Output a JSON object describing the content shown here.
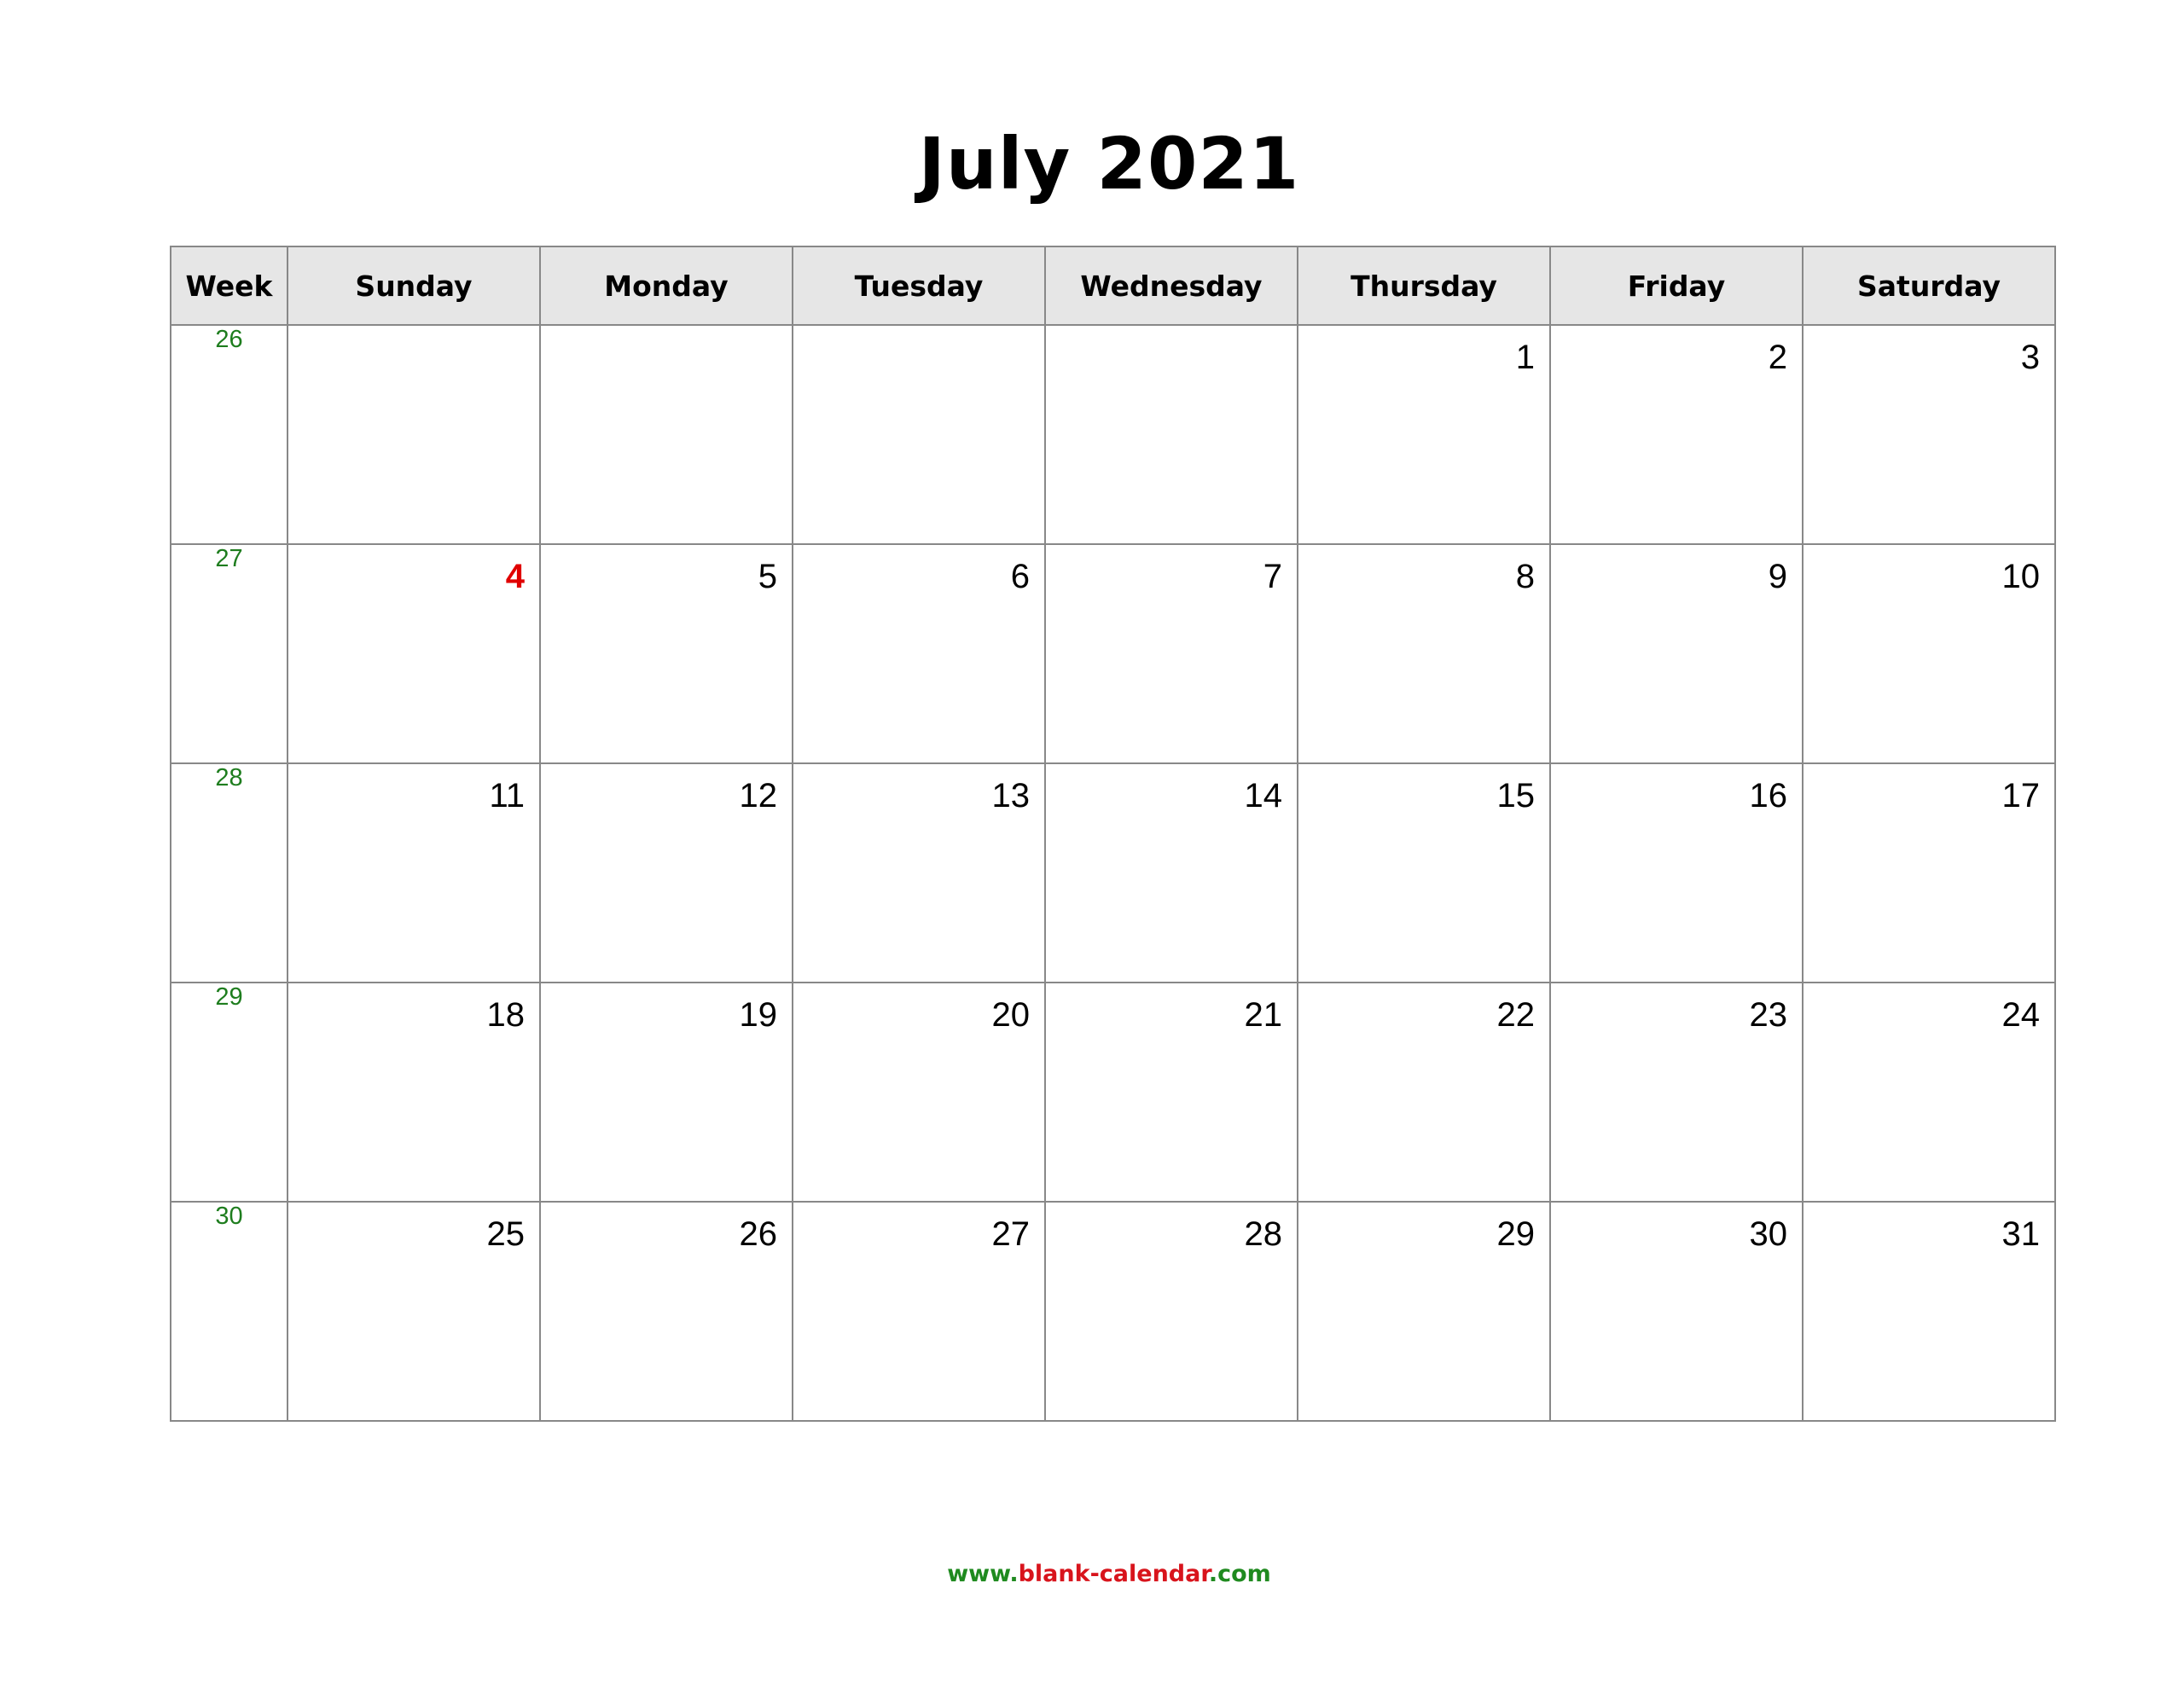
{
  "title": "July 2021",
  "header": {
    "week_label": "Week",
    "days": [
      "Sunday",
      "Monday",
      "Tuesday",
      "Wednesday",
      "Thursday",
      "Friday",
      "Saturday"
    ]
  },
  "weeks": [
    {
      "number": "26",
      "days": [
        "",
        "",
        "",
        "",
        "1",
        "2",
        "3"
      ]
    },
    {
      "number": "27",
      "days": [
        "4",
        "5",
        "6",
        "7",
        "8",
        "9",
        "10"
      ]
    },
    {
      "number": "28",
      "days": [
        "11",
        "12",
        "13",
        "14",
        "15",
        "16",
        "17"
      ]
    },
    {
      "number": "29",
      "days": [
        "18",
        "19",
        "20",
        "21",
        "22",
        "23",
        "24"
      ]
    },
    {
      "number": "30",
      "days": [
        "25",
        "26",
        "27",
        "28",
        "29",
        "30",
        "31"
      ]
    }
  ],
  "holidays": [
    "4"
  ],
  "colors": {
    "week_number": "#1e7d1e",
    "holiday": "#e00000",
    "header_bg": "#e6e6e6",
    "border": "#888888"
  },
  "footer": {
    "prefix": "www.",
    "domain": "blank-calendar",
    "suffix": ".com"
  }
}
